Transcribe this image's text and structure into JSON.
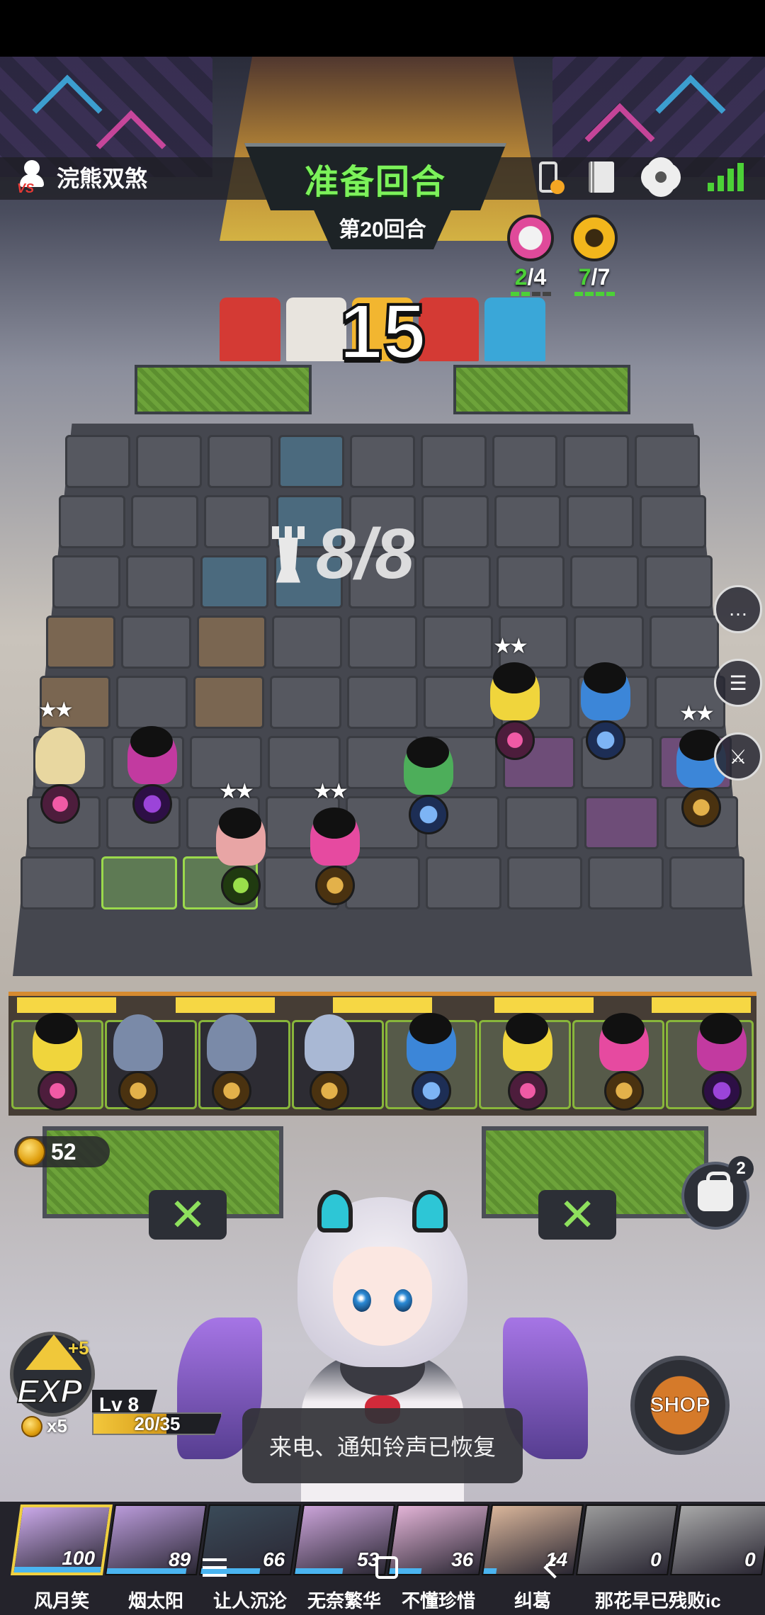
{
  "opponent": {
    "name": "浣熊双煞"
  },
  "phase": {
    "title": "准备回合",
    "round": "第20回合"
  },
  "timer": "15",
  "synergies": [
    {
      "icon": "sword-synergy-icon",
      "color": "#e04a9a",
      "current": "2",
      "total": "4",
      "display": "/4"
    },
    {
      "icon": "flame-synergy-icon",
      "color": "#f2b61c",
      "current": "7",
      "total": "7",
      "display": "/7"
    }
  ],
  "board": {
    "capacity": "8/8"
  },
  "gold": "52",
  "bag": {
    "count": "2"
  },
  "exp": {
    "label": "EXP",
    "bonus": "+5",
    "cost": "x5"
  },
  "level": {
    "label": "Lv 8",
    "xp": "20/35",
    "current": 20,
    "max": 35
  },
  "shop": {
    "label": "SHOP"
  },
  "toast": "来电、通知铃声已恢复",
  "players": [
    {
      "name": "风月笑",
      "score": "100"
    },
    {
      "name": "烟太阳",
      "score": "89"
    },
    {
      "name": "让人沉沦",
      "score": "66"
    },
    {
      "name": "无奈繁华",
      "score": "53"
    },
    {
      "name": "不懂珍惜",
      "score": "36"
    },
    {
      "name": "纠葛",
      "score": "14"
    },
    {
      "name": "那花早已残败ic",
      "score": "0"
    },
    {
      "name": "",
      "score": "0"
    }
  ],
  "colors": {
    "phase_text": "#7cf25a",
    "synergy_ok": "#4cd137",
    "gold": "#f0c83a"
  }
}
